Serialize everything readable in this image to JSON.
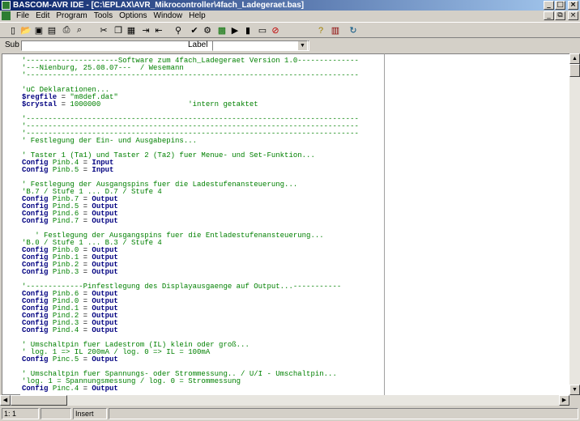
{
  "window": {
    "title": "BASCOM-AVR IDE - [C:\\EPLAX\\AVR_Mikrocontroller\\4fach_Ladegeraet.bas]",
    "minimize_glyph": "_",
    "maximize_glyph": "□",
    "close_glyph": "×",
    "restore_glyph": "⧉"
  },
  "menu": [
    "File",
    "Edit",
    "Program",
    "Tools",
    "Options",
    "Window",
    "Help"
  ],
  "toolbar": {
    "icons": [
      "new-file-icon",
      "open-file-icon",
      "save-icon",
      "save-as-icon",
      "print-icon",
      "print-preview-icon",
      "cut-icon",
      "copy-icon",
      "paste-icon",
      "indent-icon",
      "outdent-icon",
      "find-icon",
      "syntax-check-icon",
      "compile-icon",
      "program-chip-icon",
      "simulate-icon",
      "terminal-icon",
      "lcd-designer-icon",
      "stop-icon",
      "help-icon",
      "settings-icon",
      "update-icon"
    ]
  },
  "subbar": {
    "sub_label": "Sub",
    "label_label": "Label",
    "sub_value": "",
    "label_value": ""
  },
  "code_lines": [
    {
      "t": "c",
      "s": "'---------------------Software zum 4fach_Ladegeraet Version 1.0--------------"
    },
    {
      "t": "c",
      "s": "'---Nienburg, 25.08.07---  / Wesemann"
    },
    {
      "t": "c",
      "s": "'----------------------------------------------------------------------------"
    },
    {
      "t": "c",
      "s": ""
    },
    {
      "t": "c",
      "s": "'uC Deklarationen..."
    },
    {
      "t": "m",
      "k": "$regfile",
      "e": " = ",
      "v": "\"m8def.dat\"",
      "x": ""
    },
    {
      "t": "m",
      "k": "$crystal",
      "e": " = ",
      "v": "1000000",
      "x": "                    'intern getaktet"
    },
    {
      "t": "c",
      "s": ""
    },
    {
      "t": "c",
      "s": "'----------------------------------------------------------------------------"
    },
    {
      "t": "c",
      "s": "'----------------------------------------------------------------------------"
    },
    {
      "t": "c",
      "s": "'----------------------------------------------------------------------------"
    },
    {
      "t": "c",
      "s": "' Festlegung der Ein- und Ausgabepins..."
    },
    {
      "t": "c",
      "s": ""
    },
    {
      "t": "c",
      "s": "' Taster 1 (Ta1) und Taster 2 (Ta2) fuer Menue- und Set-Funktion..."
    },
    {
      "t": "p",
      "k": "Config ",
      "v": "Pinb.4",
      "e": " = ",
      "w": "Input"
    },
    {
      "t": "p",
      "k": "Config ",
      "v": "Pinb.5",
      "e": " = ",
      "w": "Input"
    },
    {
      "t": "c",
      "s": ""
    },
    {
      "t": "c",
      "s": "' Festlegung der Ausgangspins fuer die Ladestufenansteuerung..."
    },
    {
      "t": "c",
      "s": "'B.7 / Stufe 1 ... D.7 / Stufe 4"
    },
    {
      "t": "p",
      "k": "Config ",
      "v": "Pinb.7",
      "e": " = ",
      "w": "Output"
    },
    {
      "t": "p",
      "k": "Config ",
      "v": "Pind.5",
      "e": " = ",
      "w": "Output"
    },
    {
      "t": "p",
      "k": "Config ",
      "v": "Pind.6",
      "e": " = ",
      "w": "Output"
    },
    {
      "t": "p",
      "k": "Config ",
      "v": "Pind.7",
      "e": " = ",
      "w": "Output"
    },
    {
      "t": "c",
      "s": ""
    },
    {
      "t": "c",
      "s": "   ' Festlegung der Ausgangspins fuer die Entladestufenansteuerung..."
    },
    {
      "t": "c",
      "s": "'B.0 / Stufe 1 ... B.3 / Stufe 4"
    },
    {
      "t": "p",
      "k": "Config ",
      "v": "Pinb.0",
      "e": " = ",
      "w": "Output"
    },
    {
      "t": "p",
      "k": "Config ",
      "v": "Pinb.1",
      "e": " = ",
      "w": "Output"
    },
    {
      "t": "p",
      "k": "Config ",
      "v": "Pinb.2",
      "e": " = ",
      "w": "Output"
    },
    {
      "t": "p",
      "k": "Config ",
      "v": "Pinb.3",
      "e": " = ",
      "w": "Output"
    },
    {
      "t": "c",
      "s": ""
    },
    {
      "t": "c",
      "s": "'-------------Pinfestlegung des Displayausgaenge auf Output...-----------"
    },
    {
      "t": "p",
      "k": "Config ",
      "v": "Pinb.6",
      "e": " = ",
      "w": "Output"
    },
    {
      "t": "p",
      "k": "Config ",
      "v": "Pind.0",
      "e": " = ",
      "w": "Output"
    },
    {
      "t": "p",
      "k": "Config ",
      "v": "Pind.1",
      "e": " = ",
      "w": "Output"
    },
    {
      "t": "p",
      "k": "Config ",
      "v": "Pind.2",
      "e": " = ",
      "w": "Output"
    },
    {
      "t": "p",
      "k": "Config ",
      "v": "Pind.3",
      "e": " = ",
      "w": "Output"
    },
    {
      "t": "p",
      "k": "Config ",
      "v": "Pind.4",
      "e": " = ",
      "w": "Output"
    },
    {
      "t": "c",
      "s": ""
    },
    {
      "t": "c",
      "s": "' Umschaltpin fuer Ladestrom (IL) klein oder groß..."
    },
    {
      "t": "c",
      "s": "' log. 1 => IL 200mA / log. 0 => IL = 100mA"
    },
    {
      "t": "p",
      "k": "Config ",
      "v": "Pinc.5",
      "e": " = ",
      "w": "Output"
    },
    {
      "t": "c",
      "s": ""
    },
    {
      "t": "c",
      "s": "' Umschaltpin fuer Spannungs- oder Strommessung.. / U/I - Umschaltpin..."
    },
    {
      "t": "c",
      "s": "'log. 1 = Spannungsmessung / log. 0 = Strommessung"
    },
    {
      "t": "p",
      "k": "Config ",
      "v": "Pinc.4",
      "e": " = ",
      "w": "Output"
    }
  ],
  "status": {
    "position": "1: 1",
    "modified": "",
    "mode": "Insert"
  }
}
